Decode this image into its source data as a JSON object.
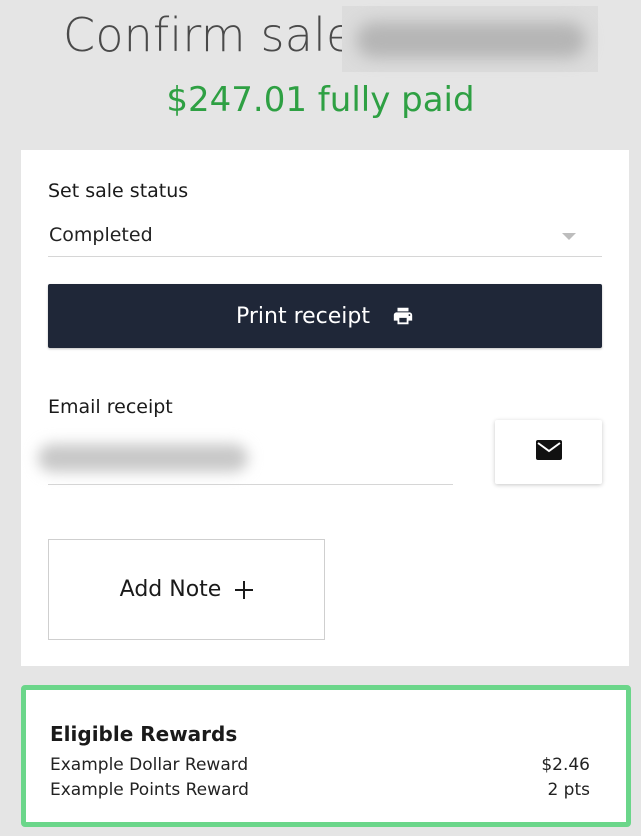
{
  "header": {
    "title": "Confirm sale",
    "paid_summary": "$247.01 fully paid"
  },
  "status": {
    "label": "Set sale status",
    "value": "Completed"
  },
  "print": {
    "label": "Print receipt",
    "icon": "printer-icon"
  },
  "email": {
    "label": "Email receipt",
    "send_icon": "mail-icon"
  },
  "note": {
    "label": "Add Note",
    "icon": "plus-icon"
  },
  "rewards": {
    "title": "Eligible Rewards",
    "items": [
      {
        "name": "Example Dollar Reward",
        "value": "$2.46"
      },
      {
        "name": "Example Points Reward",
        "value": "2 pts"
      }
    ]
  },
  "colors": {
    "accent_green": "#2ea043",
    "rewards_border": "#6bd68a",
    "print_button": "#1f2738",
    "background": "#e5e5e5"
  }
}
